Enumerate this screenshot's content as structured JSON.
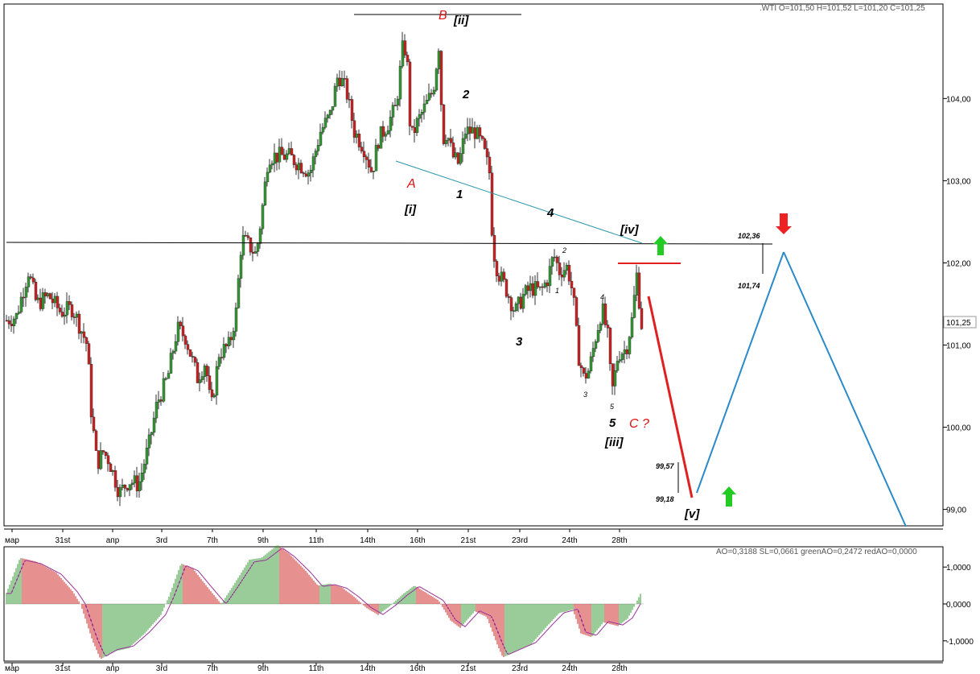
{
  "header": {
    "ohlc_label": ".WTI O=101,50 H=101,52 L=101,20 C=101,25"
  },
  "oscillator_header": {
    "label": "AO=0,3188 SL=0,0661 greenAO=0,2472 redAO=0,0000"
  },
  "chart_data": [
    {
      "type": "candlestick",
      "ylim": [
        98.8,
        105.15
      ],
      "y_ticks": [
        {
          "value": 99.0,
          "label": "99,00"
        },
        {
          "value": 100.0,
          "label": "100,00"
        },
        {
          "value": 101.0,
          "label": "101,00"
        },
        {
          "value": 102.0,
          "label": "102,00"
        },
        {
          "value": 103.0,
          "label": "103,00"
        },
        {
          "value": 104.0,
          "label": "104,00"
        }
      ],
      "x_ticks": [
        "мар",
        "31st",
        "апр",
        "3rd",
        "7th",
        "9th",
        "11th",
        "14th",
        "16th",
        "21st",
        "23rd",
        "24th",
        "28th"
      ],
      "current_price": {
        "value": 101.25,
        "label": "101,25"
      },
      "price_path": [
        [
          0,
          101.45
        ],
        [
          8,
          101.3
        ],
        [
          20,
          101.35
        ],
        [
          35,
          101.9
        ],
        [
          45,
          101.5
        ],
        [
          60,
          101.6
        ],
        [
          75,
          101.4
        ],
        [
          90,
          101.45
        ],
        [
          100,
          101.2
        ],
        [
          108,
          101.0
        ],
        [
          113,
          100.2
        ],
        [
          120,
          99.55
        ],
        [
          128,
          99.7
        ],
        [
          135,
          99.6
        ],
        [
          148,
          99.2
        ],
        [
          160,
          99.35
        ],
        [
          172,
          99.3
        ],
        [
          185,
          99.8
        ],
        [
          195,
          100.3
        ],
        [
          208,
          100.6
        ],
        [
          220,
          101.2
        ],
        [
          230,
          101.1
        ],
        [
          245,
          100.6
        ],
        [
          255,
          100.8
        ],
        [
          262,
          100.2
        ],
        [
          272,
          100.9
        ],
        [
          285,
          101.0
        ],
        [
          293,
          101.4
        ],
        [
          300,
          102.3
        ],
        [
          310,
          102.2
        ],
        [
          318,
          102.1
        ],
        [
          325,
          102.6
        ],
        [
          333,
          103.3
        ],
        [
          345,
          103.3
        ],
        [
          358,
          103.3
        ],
        [
          372,
          103.2
        ],
        [
          385,
          103.1
        ],
        [
          398,
          103.6
        ],
        [
          410,
          103.8
        ],
        [
          420,
          104.3
        ],
        [
          430,
          104.1
        ],
        [
          440,
          103.6
        ],
        [
          452,
          103.4
        ],
        [
          462,
          103.1
        ],
        [
          470,
          103.5
        ],
        [
          482,
          103.7
        ],
        [
          492,
          103.9
        ],
        [
          500,
          104.6
        ],
        [
          505,
          104.6
        ],
        [
          510,
          103.5
        ],
        [
          518,
          103.7
        ],
        [
          528,
          103.9
        ],
        [
          538,
          104.1
        ],
        [
          545,
          104.65
        ],
        [
          550,
          103.5
        ],
        [
          555,
          103.6
        ],
        [
          562,
          103.3
        ],
        [
          570,
          103.2
        ],
        [
          578,
          103.6
        ],
        [
          590,
          103.6
        ],
        [
          600,
          103.4
        ],
        [
          608,
          103.1
        ],
        [
          612,
          102.2
        ],
        [
          618,
          101.9
        ],
        [
          628,
          101.7
        ],
        [
          640,
          101.4
        ],
        [
          650,
          101.6
        ],
        [
          660,
          101.7
        ],
        [
          672,
          101.65
        ],
        [
          680,
          101.8
        ],
        [
          688,
          102.1
        ],
        [
          695,
          101.9
        ],
        [
          705,
          101.95
        ],
        [
          712,
          101.6
        ],
        [
          718,
          100.9
        ],
        [
          725,
          100.6
        ],
        [
          732,
          100.7
        ],
        [
          740,
          101.1
        ],
        [
          748,
          101.45
        ],
        [
          755,
          101.1
        ],
        [
          760,
          100.4
        ],
        [
          768,
          100.9
        ],
        [
          778,
          100.95
        ],
        [
          785,
          101.3
        ],
        [
          791,
          101.85
        ],
        [
          797,
          101.25
        ]
      ]
    },
    {
      "type": "histogram",
      "ylim": [
        -1.55,
        1.55
      ],
      "y_ticks": [
        {
          "value": 1.0,
          "label": "1,0000"
        },
        {
          "value": 0.0,
          "label": "0,0000"
        },
        {
          "value": -1.0,
          "label": "-1,0000"
        }
      ],
      "x_ticks": [
        "мар",
        "31st",
        "апр",
        "3rd",
        "7th",
        "9th",
        "11th",
        "14th",
        "16th",
        "21st",
        "23rd",
        "24th",
        "28th"
      ],
      "ao_path": [
        [
          8,
          0.3
        ],
        [
          25,
          1.25
        ],
        [
          45,
          1.15
        ],
        [
          70,
          0.85
        ],
        [
          90,
          0.35
        ],
        [
          100,
          0.0
        ],
        [
          115,
          -1.0
        ],
        [
          125,
          -1.5
        ],
        [
          140,
          -1.3
        ],
        [
          160,
          -1.2
        ],
        [
          180,
          -0.8
        ],
        [
          200,
          -0.3
        ],
        [
          210,
          0.2
        ],
        [
          225,
          1.1
        ],
        [
          240,
          0.95
        ],
        [
          260,
          0.4
        ],
        [
          275,
          0.0
        ],
        [
          290,
          0.5
        ],
        [
          310,
          1.2
        ],
        [
          325,
          1.25
        ],
        [
          345,
          1.6
        ],
        [
          360,
          1.35
        ],
        [
          380,
          0.9
        ],
        [
          395,
          0.5
        ],
        [
          410,
          0.55
        ],
        [
          425,
          0.45
        ],
        [
          440,
          0.2
        ],
        [
          455,
          -0.1
        ],
        [
          470,
          -0.3
        ],
        [
          485,
          -0.05
        ],
        [
          500,
          0.25
        ],
        [
          515,
          0.5
        ],
        [
          530,
          0.3
        ],
        [
          545,
          0.1
        ],
        [
          560,
          -0.45
        ],
        [
          572,
          -0.65
        ],
        [
          590,
          -0.2
        ],
        [
          605,
          -0.35
        ],
        [
          618,
          -1.1
        ],
        [
          625,
          -1.45
        ],
        [
          640,
          -1.3
        ],
        [
          660,
          -1.1
        ],
        [
          680,
          -0.6
        ],
        [
          695,
          -0.25
        ],
        [
          712,
          -0.15
        ],
        [
          722,
          -0.8
        ],
        [
          735,
          -0.9
        ],
        [
          750,
          -0.5
        ],
        [
          768,
          -0.6
        ],
        [
          780,
          -0.4
        ],
        [
          790,
          0.0
        ],
        [
          797,
          0.32
        ]
      ]
    }
  ],
  "annotations": {
    "wave_A": "A",
    "wave_B": "B",
    "wave_ii": "[ii]",
    "wave_i": "[i]",
    "wave_1": "1",
    "wave_2": "2",
    "wave_3": "3",
    "wave_4": "4",
    "wave_5": "5",
    "wave_iii": "[iii]",
    "wave_iv": "[iv]",
    "wave_v": "[v]",
    "wave_C": "C ?",
    "sub_1": "1",
    "sub_2": "2",
    "sub_3": "3",
    "sub_4": "4",
    "sub_5": "5",
    "level_top": "102,36",
    "level_mid": "101,74",
    "level_upper_target": "99,57",
    "level_lower_target": "99,18"
  },
  "colors": {
    "bull": "#339933",
    "bear": "#cc2222",
    "trendline": "#2a9aa8",
    "forecast_down": "#e02020",
    "forecast_up": "#2a8ac8",
    "arrow_up": "#22cc22",
    "arrow_down": "#ee2222"
  }
}
